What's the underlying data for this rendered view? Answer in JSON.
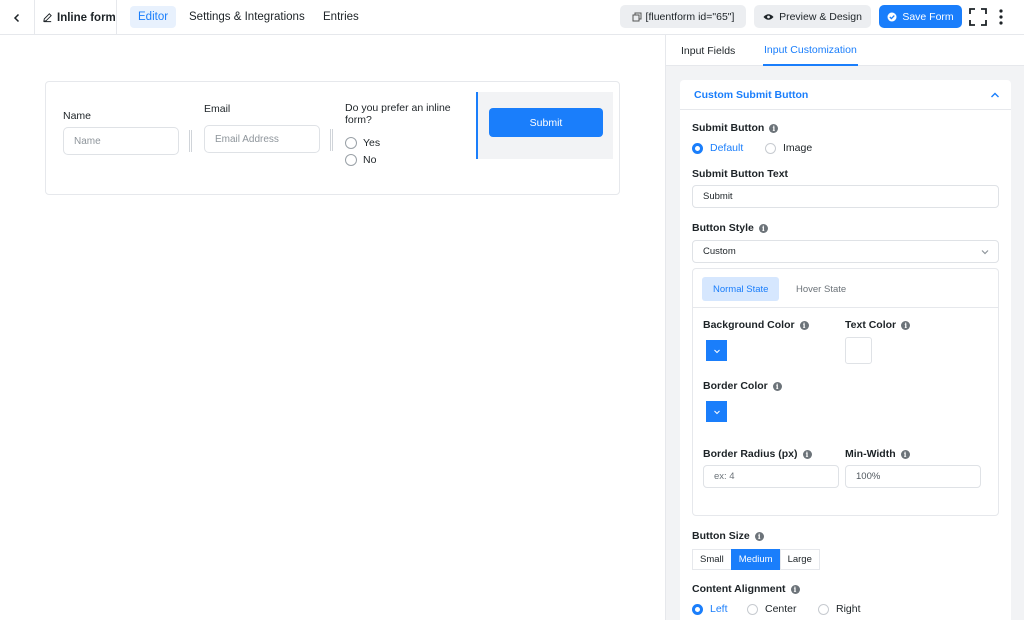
{
  "header": {
    "form_title": "Inline form",
    "tabs": [
      {
        "label": "Editor",
        "active": true
      },
      {
        "label": "Settings & Integrations",
        "active": false
      },
      {
        "label": "Entries",
        "active": false
      }
    ],
    "shortcode": "[fluentform id=\"65\"]",
    "preview_label": "Preview & Design",
    "save_label": "Save Form"
  },
  "form": {
    "name_label": "Name",
    "name_placeholder": "Name",
    "email_label": "Email",
    "email_placeholder": "Email Address",
    "question_label": "Do you prefer an inline form?",
    "options": [
      "Yes",
      "No"
    ],
    "submit_label": "Submit"
  },
  "panel": {
    "tabs": [
      {
        "label": "Input Fields",
        "active": false
      },
      {
        "label": "Input Customization",
        "active": true
      }
    ],
    "section_title": "Custom Submit Button",
    "submit_button_label": "Submit Button",
    "submit_button_options": [
      {
        "label": "Default",
        "checked": true
      },
      {
        "label": "Image",
        "checked": false
      }
    ],
    "submit_text_label": "Submit Button Text",
    "submit_text_value": "Submit",
    "button_style_label": "Button Style",
    "button_style_value": "Custom",
    "state_tabs": [
      {
        "label": "Normal State",
        "active": true
      },
      {
        "label": "Hover State",
        "active": false
      }
    ],
    "bg_color_label": "Background Color",
    "text_color_label": "Text Color",
    "border_color_label": "Border Color",
    "border_radius_label": "Border Radius (px)",
    "border_radius_placeholder": "ex: 4",
    "min_width_label": "Min-Width",
    "min_width_value": "100%",
    "button_size_label": "Button Size",
    "button_sizes": [
      {
        "label": "Small",
        "active": false
      },
      {
        "label": "Medium",
        "active": true
      },
      {
        "label": "Large",
        "active": false
      }
    ],
    "alignment_label": "Content Alignment",
    "alignment_options": [
      {
        "label": "Left",
        "checked": true
      },
      {
        "label": "Center",
        "checked": false
      },
      {
        "label": "Right",
        "checked": false
      }
    ]
  },
  "colors": {
    "accent": "#1a7efb",
    "background_color_swatch": "#1a7efb",
    "border_color_swatch": "#1a7efb",
    "text_color_swatch": "#ffffff"
  },
  "icons": [
    "chevron-left-icon",
    "pencil-icon",
    "copy-icon",
    "eye-icon",
    "check-circle-icon",
    "fullscreen-icon",
    "more-vertical-icon",
    "chevron-up-icon",
    "chevron-down-icon",
    "info-icon"
  ]
}
